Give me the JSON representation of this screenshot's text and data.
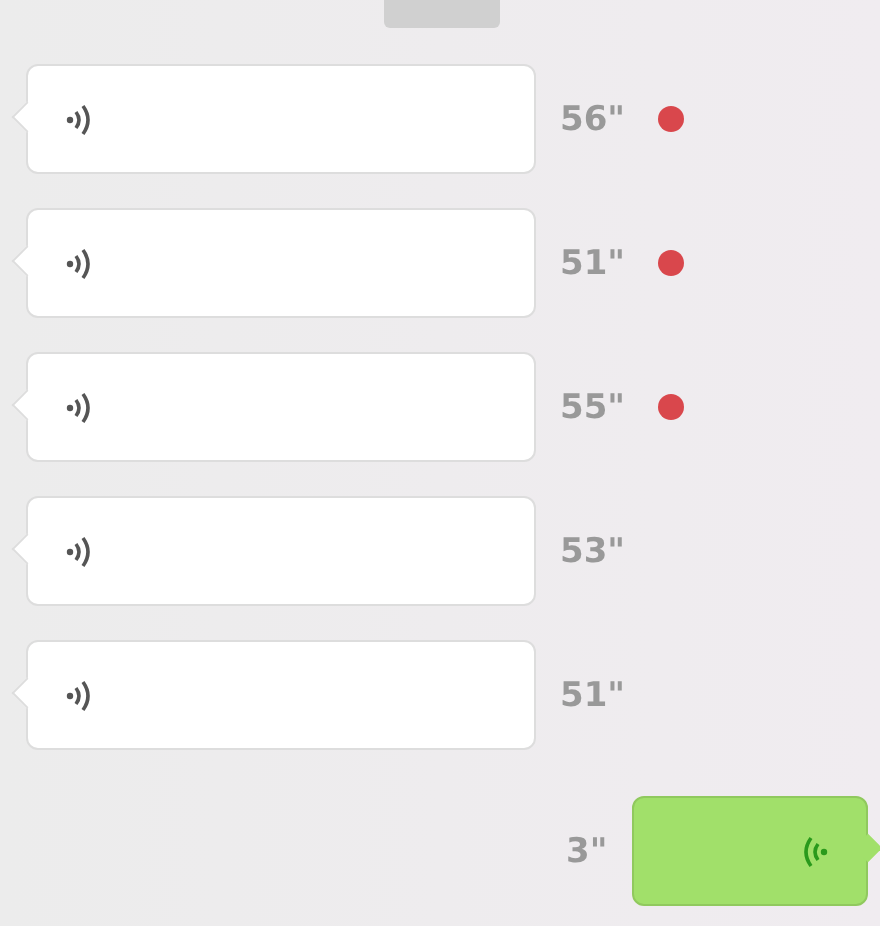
{
  "messages": [
    {
      "kind": "received",
      "duration": "56\"",
      "unread": true
    },
    {
      "kind": "received",
      "duration": "51\"",
      "unread": true
    },
    {
      "kind": "received",
      "duration": "55\"",
      "unread": true
    },
    {
      "kind": "received",
      "duration": "53\"",
      "unread": false
    },
    {
      "kind": "received",
      "duration": "51\"",
      "unread": false
    },
    {
      "kind": "sent",
      "duration": "3\""
    }
  ]
}
